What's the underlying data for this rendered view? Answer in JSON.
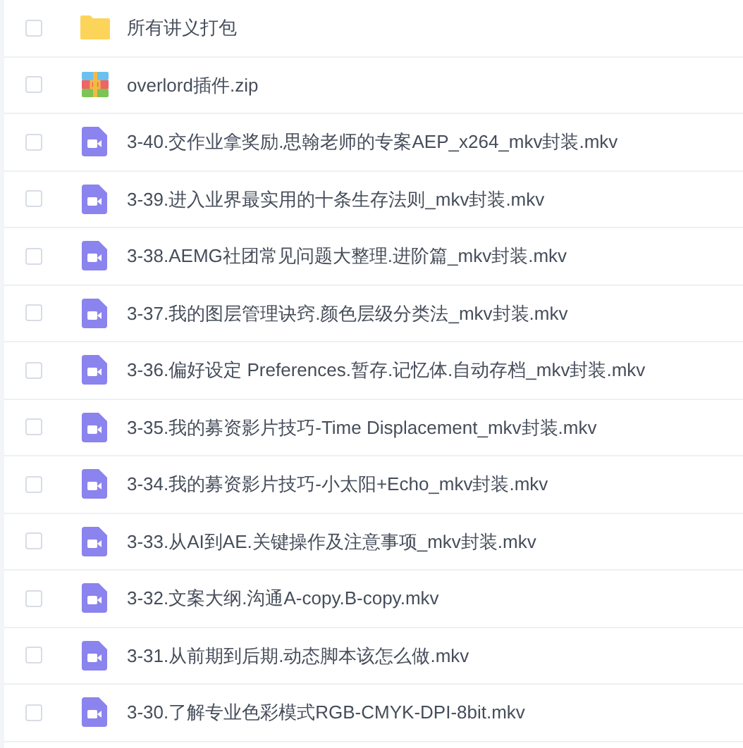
{
  "files": [
    {
      "kind": "folder",
      "name": "所有讲义打包",
      "checked": false
    },
    {
      "kind": "zip",
      "name": "overlord插件.zip",
      "checked": false
    },
    {
      "kind": "video",
      "name": "3-40.交作业拿奖励.思翰老师的专案AEP_x264_mkv封装.mkv",
      "checked": false
    },
    {
      "kind": "video",
      "name": "3-39.进入业界最实用的十条生存法则_mkv封装.mkv",
      "checked": false
    },
    {
      "kind": "video",
      "name": "3-38.AEMG社团常见问题大整理.进阶篇_mkv封装.mkv",
      "checked": false
    },
    {
      "kind": "video",
      "name": "3-37.我的图层管理诀窍.颜色层级分类法_mkv封装.mkv",
      "checked": false
    },
    {
      "kind": "video",
      "name": "3-36.偏好设定 Preferences.暂存.记忆体.自动存档_mkv封装.mkv",
      "checked": false
    },
    {
      "kind": "video",
      "name": "3-35.我的募资影片技巧-Time Displacement_mkv封装.mkv",
      "checked": false
    },
    {
      "kind": "video",
      "name": "3-34.我的募资影片技巧-小太阳+Echo_mkv封装.mkv",
      "checked": false
    },
    {
      "kind": "video",
      "name": "3-33.从AI到AE.关键操作及注意事项_mkv封装.mkv",
      "checked": false
    },
    {
      "kind": "video",
      "name": "3-32.文案大纲.沟通A-copy.B-copy.mkv",
      "checked": false
    },
    {
      "kind": "video",
      "name": "3-31.从前期到后期.动态脚本该怎么做.mkv",
      "checked": false
    },
    {
      "kind": "video",
      "name": "3-30.了解专业色彩模式RGB-CMYK-DPI-8bit.mkv",
      "checked": false
    }
  ]
}
